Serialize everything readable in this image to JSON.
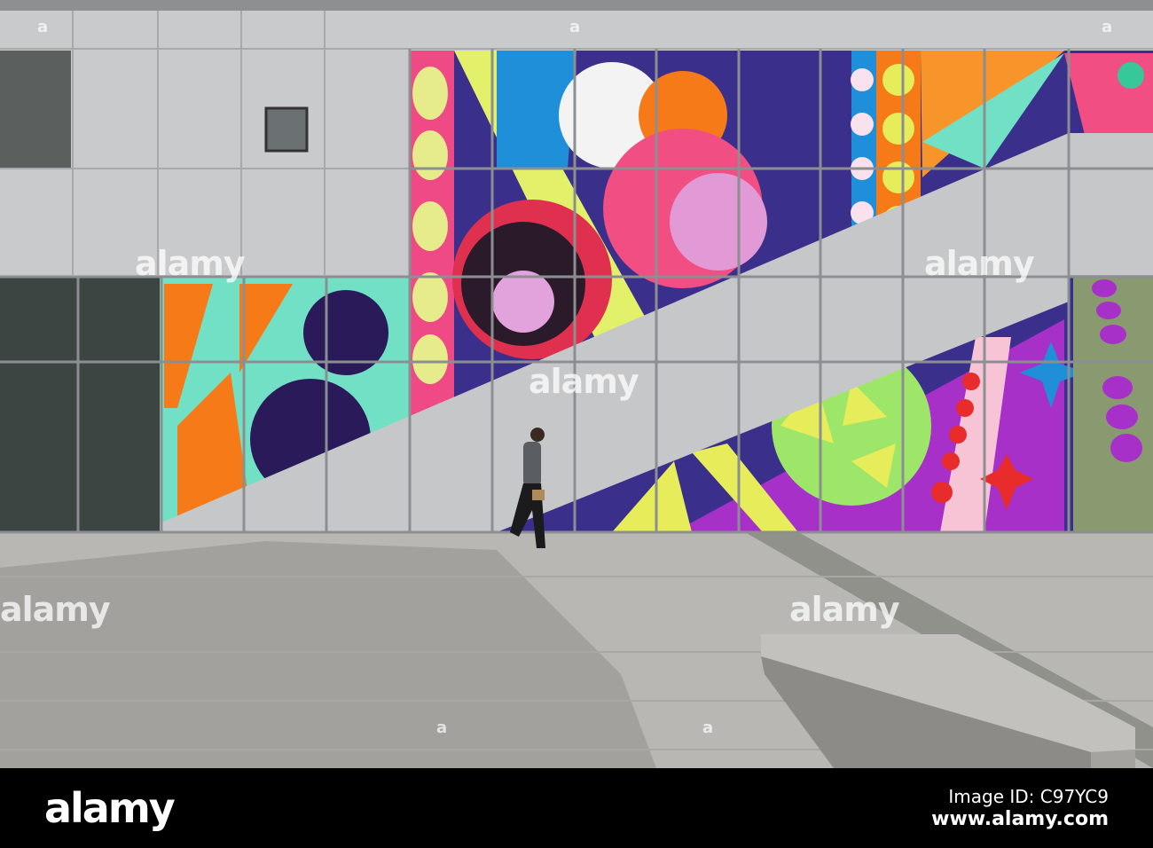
{
  "watermark": {
    "text": "alamy",
    "mark": "a"
  },
  "footer": {
    "logo": "alamy",
    "image_id": "Image ID: C97YC9",
    "website": "www.alamy.com"
  }
}
